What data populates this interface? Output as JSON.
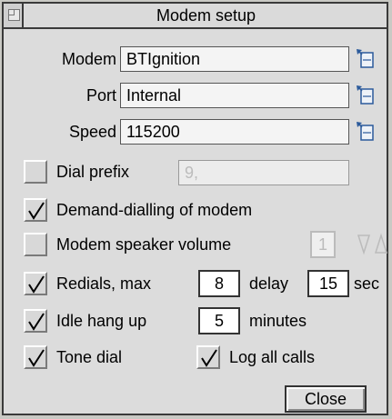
{
  "window": {
    "title": "Modem setup"
  },
  "modem": {
    "label": "Modem",
    "value": "BTIgnition"
  },
  "port": {
    "label": "Port",
    "value": "Internal"
  },
  "speed": {
    "label": "Speed",
    "value": "115200"
  },
  "dial_prefix": {
    "label": "Dial prefix",
    "value": "9,",
    "checked": false
  },
  "demand_dialling": {
    "label": "Demand-dialling of modem",
    "checked": true
  },
  "speaker_volume": {
    "label": "Modem speaker volume",
    "value": "1",
    "checked": false
  },
  "redials": {
    "label": "Redials, max",
    "max": "8",
    "delay_label": "delay",
    "delay": "15",
    "unit": "sec",
    "checked": true
  },
  "idle_hangup": {
    "label": "Idle hang up",
    "value": "5",
    "unit": "minutes",
    "checked": true
  },
  "tone_dial": {
    "label": "Tone dial",
    "checked": true
  },
  "log_calls": {
    "label": "Log all calls",
    "checked": true
  },
  "close_button": {
    "label": "Close"
  },
  "icons": {
    "popup": "popup-menu-icon",
    "check": "check-mark-icon",
    "updown": "up-down-arrow-icon",
    "back": "window-back-icon"
  }
}
